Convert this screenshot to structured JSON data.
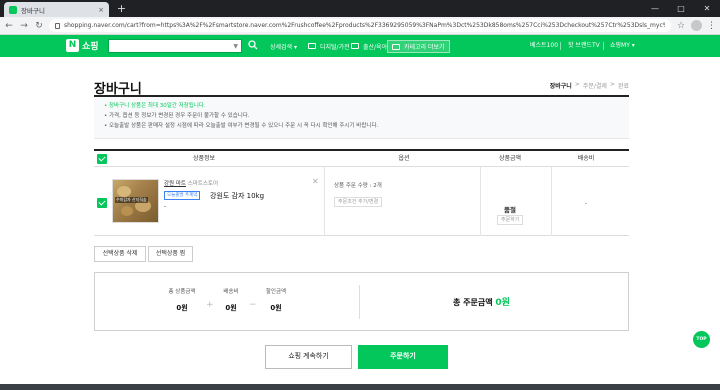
{
  "browser": {
    "tab_title": "장바구니",
    "tab_close": "×",
    "new_tab": "+",
    "url": "shopping.naver.com/cart?from=https%3A%2F%2Fsmartstore.naver.com%2Frushcoffee%2Fproducts%2F3369295059%3FNaPm%3Dct%253Dk858oms%257Cci%253Dcheckout%257Ctr%253Dsls_myc%257Ctr..."
  },
  "header": {
    "logo_mark": "N",
    "logo_word": "쇼핑",
    "nav": [
      {
        "label": "상세검색 ▾"
      },
      {
        "label": "디지털/가전"
      },
      {
        "label": "출산/육아"
      },
      {
        "label": "카테고리 더보기"
      }
    ],
    "best": "베스트100",
    "brand": "핫 브랜드TV",
    "my": "쇼핑MY ▾"
  },
  "page": {
    "title": "장바구니",
    "breadcrumb": [
      "장바구니",
      ">",
      "주문/결제",
      ">",
      "완료"
    ]
  },
  "notice": [
    "• 장바구니 상품은 최대 30일간 저장됩니다.",
    "• 가격, 옵션 등 정보가 변경된 경우 주문이 불가할 수 있습니다.",
    "• 오늘출발 상품은 판매자 설정 시점에 따라 오늘출발 여부가 변경될 수 있으니 주문 시 꼭 다시 확인해 주시기 바랍니다."
  ],
  "table": {
    "headers": [
      "상품정보",
      "옵션",
      "상품금액",
      "배송비"
    ]
  },
  "item": {
    "shop": "강원 마트",
    "shop_sub": "스마트스토어",
    "badge": "오늘출발 주계약",
    "name": "강원도 감자 10kg",
    "dash": "-",
    "thumb_label": "수미감자 산지직송",
    "option_text": "상품 주문 수량 : 2개",
    "option_button": "주문조건 추가/변경",
    "status": "품절",
    "status_button": "주문하기",
    "shipping": "-"
  },
  "actions": {
    "delete_selected": "선택상품 삭제",
    "wish_selected": "선택상품 찜"
  },
  "summary": {
    "product_label": "총 상품금액",
    "product_value": "0원",
    "plus": "+",
    "ship_label": "배송비",
    "ship_value": "0원",
    "minus": "−",
    "discount_label": "할인금액",
    "discount_value": "0원",
    "total_label": "총 주문금액",
    "total_value": "0원"
  },
  "buttons": {
    "continue": "쇼핑 계속하기",
    "order": "주문하기",
    "top": "TOP"
  },
  "colors": {
    "brand_green": "#03c75a",
    "browser_dark": "#202124"
  }
}
